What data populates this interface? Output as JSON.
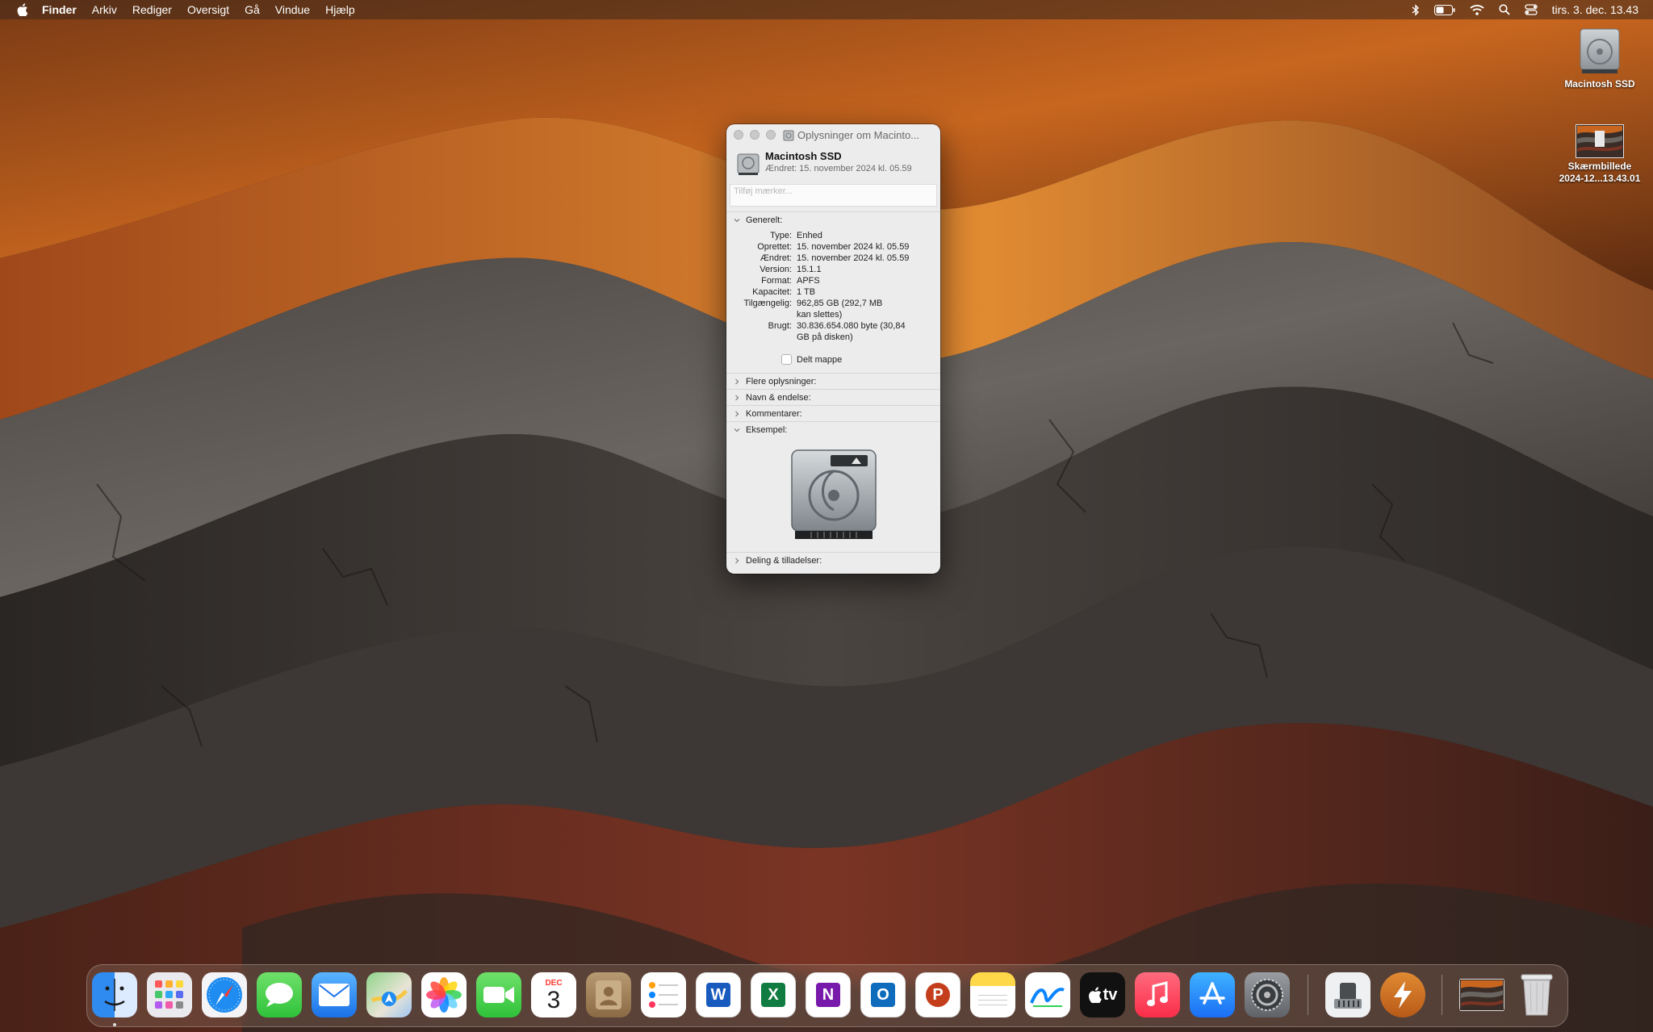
{
  "menubar": {
    "app": "Finder",
    "items": [
      "Arkiv",
      "Rediger",
      "Oversigt",
      "Gå",
      "Vindue",
      "Hjælp"
    ],
    "clock": "tirs. 3. dec. 13.43",
    "status_icons": [
      "bluetooth-icon",
      "battery-icon",
      "wifi-icon",
      "search-icon",
      "control-center-icon"
    ]
  },
  "desktop": {
    "icons": [
      {
        "label": "Macintosh SSD",
        "icon": "hard-drive-icon"
      },
      {
        "label_line1": "Skærmbillede",
        "label_line2": "2024-12...13.43.01",
        "icon": "screenshot-thumbnail"
      }
    ]
  },
  "info_window": {
    "title": "Oplysninger om Macinto...",
    "name": "Macintosh SSD",
    "modified_summary": "Ændret: 15. november 2024 kl. 05.59",
    "tags_placeholder": "Tilføj mærker...",
    "sections": {
      "general": "Generelt:",
      "more_info": "Flere oplysninger:",
      "name_ext": "Navn & endelse:",
      "comments": "Kommentarer:",
      "preview": "Eksempel:",
      "sharing": "Deling & tilladelser:"
    },
    "general": {
      "type_k": "Type:",
      "type_v": "Enhed",
      "created_k": "Oprettet:",
      "created_v": "15. november 2024 kl. 05.59",
      "modified_k": "Ændret:",
      "modified_v": "15. november 2024 kl. 05.59",
      "version_k": "Version:",
      "version_v": "15.1.1",
      "format_k": "Format:",
      "format_v": "APFS",
      "capacity_k": "Kapacitet:",
      "capacity_v": "1 TB",
      "available_k": "Tilgængelig:",
      "available_v1": "962,85 GB (292,7 MB",
      "available_v2": "kan slettes)",
      "used_k": "Brugt:",
      "used_v1": "30.836.654.080 byte (30,84",
      "used_v2": "GB på disken)"
    },
    "shared_folder": "Delt mappe"
  },
  "dock": {
    "apps": [
      "Finder",
      "Launchpad",
      "Safari",
      "Beskeder",
      "Mail",
      "Kort",
      "Fotos",
      "FaceTime",
      "Kalender",
      "Kontakter",
      "Påmindelser",
      "Word",
      "Excel",
      "OneNote",
      "Outlook",
      "PowerPoint",
      "Noter",
      "Freeform",
      "TV",
      "Musik",
      "App Store",
      "Systemindstillinger",
      "Systeminformation",
      "Reeder",
      "Skærmbillede",
      "Papirkurv"
    ],
    "calendar_month": "DEC",
    "calendar_day": "3",
    "word_letter": "W",
    "excel_letter": "X",
    "onenote_letter": "N",
    "outlook_letter": "O",
    "powerpoint_letter": "P",
    "tv_label": "tv"
  }
}
